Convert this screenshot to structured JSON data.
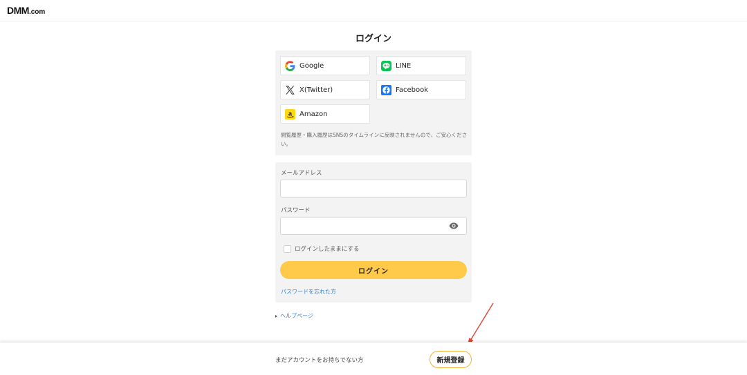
{
  "header": {
    "logo_main": "DMM",
    "logo_suffix": ".com"
  },
  "page": {
    "title": "ログイン"
  },
  "sns": {
    "buttons": [
      {
        "label": "Google",
        "icon": "google-icon"
      },
      {
        "label": "LINE",
        "icon": "line-icon"
      },
      {
        "label": "X(Twitter)",
        "icon": "x-twitter-icon"
      },
      {
        "label": "Facebook",
        "icon": "facebook-icon"
      },
      {
        "label": "Amazon",
        "icon": "amazon-icon"
      }
    ],
    "note": "閲覧履歴・購入履歴はSNSのタイムラインに反映されませんので、ご安心ください。"
  },
  "form": {
    "email_label": "メールアドレス",
    "email_value": "",
    "password_label": "パスワード",
    "password_value": "",
    "remember_label": "ログインしたままにする",
    "login_button": "ログイン",
    "forgot_link": "パスワードを忘れた方"
  },
  "help": {
    "label": "ヘルプページ"
  },
  "footer": {
    "text": "まだアカウントをお持ちでない方",
    "signup_button": "新規登録"
  },
  "colors": {
    "accent": "#ffc94a",
    "link": "#2f7fd1",
    "panel": "#f3f3f3",
    "annotation": "#e04a3a"
  }
}
